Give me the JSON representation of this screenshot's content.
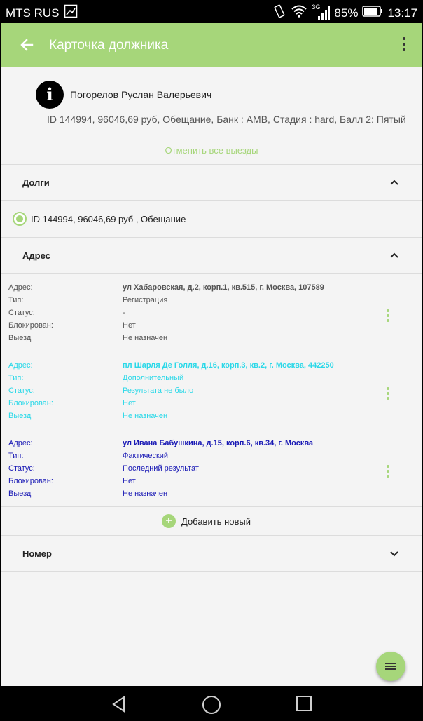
{
  "status_bar": {
    "carrier": "MTS RUS",
    "network": "3G",
    "battery": "85%",
    "time": "13:17"
  },
  "app_bar": {
    "title": "Карточка должника"
  },
  "debtor": {
    "name": "Погорелов Руслан Валерьевич",
    "details": "ID 144994, 96046,69 руб, Обещание, Банк : AMB, Стадия : hard, Балл 2: Пятый",
    "cancel_all": "Отменить все выезды"
  },
  "sections": {
    "debts": {
      "title": "Долги",
      "items": [
        {
          "label": "ID 144994, 96046,69 руб , Обещание",
          "selected": true
        }
      ]
    },
    "address": {
      "title": "Адрес",
      "field_labels": [
        "Адрес:",
        "Тип:",
        "Статус:",
        "Блокирован:",
        "Выезд"
      ],
      "items": [
        {
          "address": "ул Хабаровская, д.2, корп.1, кв.515, г. Москва, 107589",
          "type": "Регистрация",
          "status": "-",
          "blocked": "Нет",
          "visit": "Не назначен",
          "color": "#555555"
        },
        {
          "address": "пл Шарля Де Голля, д.16, корп.3, кв.2, г. Москва, 442250",
          "type": "Дополнительный",
          "status": "Результата не было",
          "blocked": "Нет",
          "visit": "Не назначен",
          "color": "#2ad8e8"
        },
        {
          "address": "ул Ивана Бабушкина, д.15, корп.6, кв.34, г. Москва",
          "type": "Фактический",
          "status": "Последний результат",
          "blocked": "Нет",
          "visit": "Не назначен",
          "color": "#1a1ab5"
        }
      ],
      "add_new": "Добавить новый"
    },
    "number": {
      "title": "Номер"
    }
  },
  "icons": {
    "back": "arrow-left-icon",
    "more": "more-vert-icon",
    "info": "info-icon",
    "fab": "list-icon"
  },
  "colors": {
    "accent": "#a6d67a"
  }
}
